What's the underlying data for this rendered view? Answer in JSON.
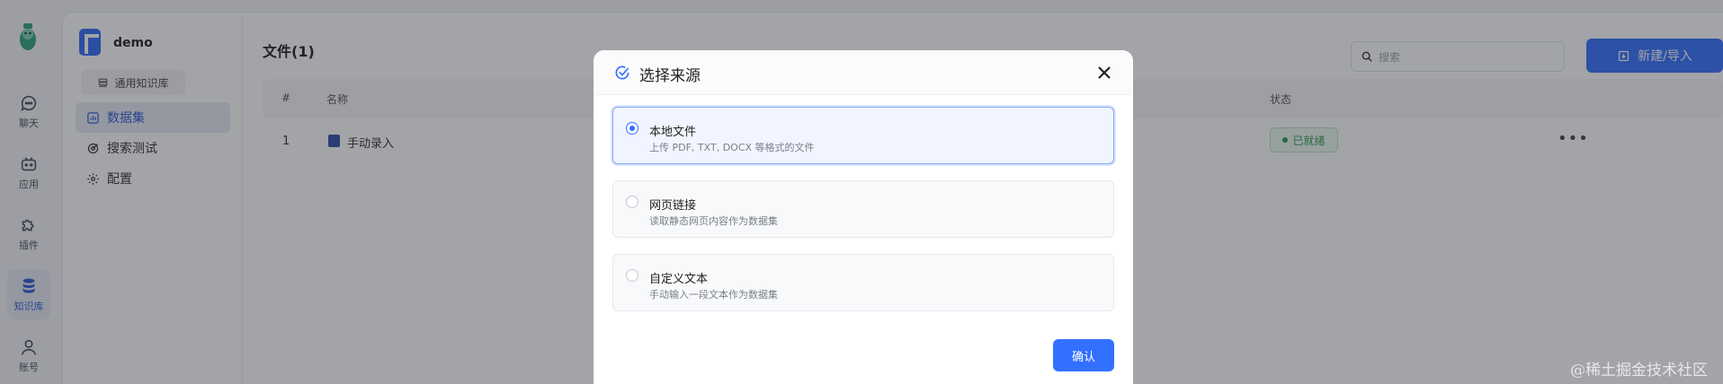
{
  "rail": {
    "items": [
      {
        "label": "聊天",
        "icon": "chat-icon"
      },
      {
        "label": "应用",
        "icon": "robot-icon"
      },
      {
        "label": "插件",
        "icon": "puzzle-icon"
      },
      {
        "label": "知识库",
        "icon": "database-icon",
        "active": true
      },
      {
        "label": "账号",
        "icon": "user-icon"
      }
    ]
  },
  "dataset": {
    "name": "demo",
    "tag": "通用知识库",
    "nav": [
      {
        "label": "数据集",
        "icon": "chart-icon",
        "active": true
      },
      {
        "label": "搜索测试",
        "icon": "target-icon"
      },
      {
        "label": "配置",
        "icon": "gear-icon"
      }
    ]
  },
  "content": {
    "title": "文件(1)",
    "search_placeholder": "搜索",
    "new_button": "新建/导入",
    "columns": [
      "#",
      "名称",
      "状态"
    ],
    "rows": [
      {
        "index": "1",
        "name": "手动录入",
        "status": "已就绪"
      }
    ],
    "more": "•••"
  },
  "modal": {
    "title": "选择来源",
    "options": [
      {
        "title": "本地文件",
        "desc": "上传 PDF, TXT, DOCX 等格式的文件",
        "selected": true
      },
      {
        "title": "网页链接",
        "desc": "读取静态网页内容作为数据集",
        "selected": false
      },
      {
        "title": "自定义文本",
        "desc": "手动输入一段文本作为数据集",
        "selected": false
      }
    ],
    "confirm": "确认"
  },
  "watermark": "@稀土掘金技术社区",
  "colors": {
    "accent": "#3370ff",
    "success": "#2a9a4f"
  }
}
